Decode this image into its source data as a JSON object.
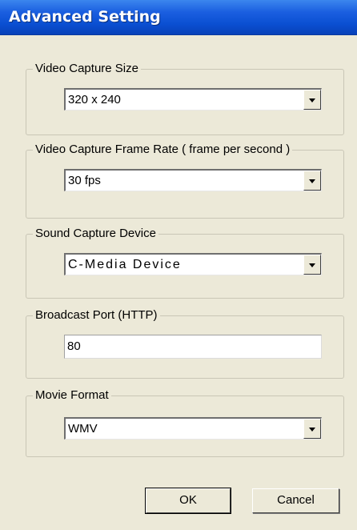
{
  "window": {
    "title": "Advanced Setting"
  },
  "groups": {
    "video_size": {
      "label": "Video Capture Size",
      "value": "320 x 240"
    },
    "frame_rate": {
      "label": "Video Capture Frame Rate ( frame per second )",
      "value": "30 fps"
    },
    "sound_device": {
      "label": "Sound Capture Device",
      "value": "C-Media Device"
    },
    "broadcast_port": {
      "label": "Broadcast Port (HTTP)",
      "value": "80"
    },
    "movie_format": {
      "label": "Movie Format",
      "value": "WMV"
    }
  },
  "buttons": {
    "ok": "OK",
    "cancel": "Cancel"
  },
  "icons": {
    "dropdown": "chevron-down-icon"
  },
  "colors": {
    "title_bar": "#0a4fd2",
    "dialog_bg": "#ece9d8"
  }
}
